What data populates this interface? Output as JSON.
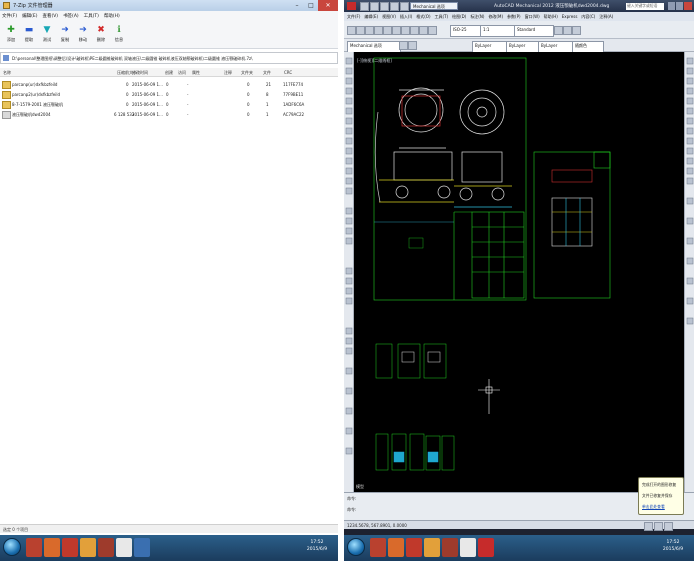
{
  "archive_window": {
    "title": "7-Zip 文件管理器",
    "menu": [
      "文件(F)",
      "编辑(E)",
      "查看(V)",
      "书签(A)",
      "工具(T)",
      "帮助(H)"
    ],
    "toolbar": [
      "添加",
      "提取",
      "测试",
      "复制",
      "移动",
      "删除",
      "信息"
    ],
    "path": "D:\\personal\\整理图纸\\调整后\\设计\\破碎机\\PE二级圆锥破碎机 双轴液压\\二级圆锥 破碎机液压双轴颚破碎机\\二级圆锥 液压颚破碎机.7z\\",
    "columns": [
      "名称",
      "压缩前大小",
      "修改时间",
      "创建",
      "访问",
      "属性",
      "注释",
      "CRC",
      "文件夹",
      "文件"
    ],
    "rows": [
      {
        "name": "parcanp(ur)dxfkbzfeild",
        "size": "0",
        "modified": "2015-06-09 1...",
        "created": "0",
        "accessed": "-",
        "folders": "0",
        "files": "21",
        "crc": "117FE774"
      },
      {
        "name": "parcanp2(ur)dxfkbzfeild",
        "size": "0",
        "modified": "2015-06-09 1...",
        "created": "0",
        "accessed": "-",
        "folders": "0",
        "files": "8",
        "crc": "77F9BE11"
      },
      {
        "name": "8-7-1579-2001 液压颚破机",
        "size": "0",
        "modified": "2015-06-09 1...",
        "created": "0",
        "accessed": "-",
        "folders": "0",
        "files": "1",
        "crc": "1ADF6C6A"
      },
      {
        "name": "液压颚破机dwd2004",
        "size": "6 128 533",
        "modified": "2015-06-09 1...",
        "created": "0",
        "accessed": "-",
        "folders": "0",
        "files": "1",
        "crc": "AC79AC22"
      }
    ],
    "status": "选定 0 个项目"
  },
  "cad_window": {
    "title": "AutoCAD Mechanical 2012   液压颚破机dwd2004.dwg",
    "workspace": "Mechanical 选项",
    "search_placeholder": "键入关键字或短语",
    "menu": [
      "文件(F)",
      "编辑(E)",
      "视图(V)",
      "插入(I)",
      "格式(O)",
      "工具(T)",
      "绘图(D)",
      "标注(N)",
      "修改(M)",
      "参数(P)",
      "窗口(W)",
      "帮助(H)",
      "Express",
      "内容(C)",
      "注释(A)"
    ],
    "combo_style": "ISO-25",
    "combo_scale": "1:1",
    "combo_standard": "Standard",
    "combo_layer": "Mechanical 选项",
    "combo_color": "ByLayer",
    "combo_linetype": "ByLayer",
    "combo_lineweight": "ByLayer",
    "combo_plot": "随颜色",
    "viewport_label": "[-][俯视][二维线框]",
    "model_tab": "模型",
    "command_prompt_1": "命令:",
    "command_prompt_2": "命令:",
    "coordinates": "1234.5678, 567.8901, 0.0000",
    "popup_line1": "完成打开的图形修复",
    "popup_line2": "文件已修复并保存",
    "popup_link": "单击此处查看"
  },
  "taskbar": {
    "time": "17:52",
    "date": "2015/6/9"
  }
}
